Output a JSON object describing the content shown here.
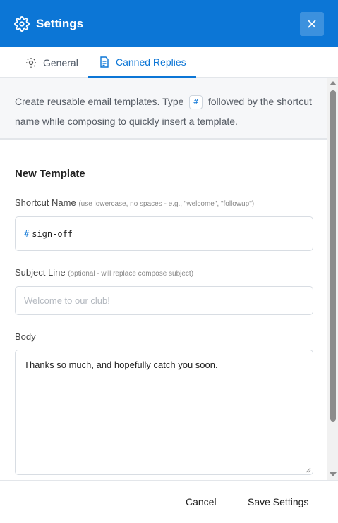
{
  "header": {
    "title": "Settings",
    "close_icon": "close-icon",
    "gear_icon": "gear-icon",
    "color": "#0c76d6"
  },
  "tabs": [
    {
      "label": "General",
      "icon": "sun-settings-icon",
      "active": false
    },
    {
      "label": "Canned Replies",
      "icon": "document-icon",
      "active": true
    }
  ],
  "info": {
    "text_before": "Create reusable email templates. Type",
    "chip": "#",
    "text_after": "followed by the shortcut name while composing to quickly insert a template."
  },
  "form": {
    "section_title": "New Template",
    "shortcut": {
      "label": "Shortcut Name",
      "hint": "(use lowercase, no spaces - e.g., \"welcome\", \"followup\")",
      "prefix": "#",
      "value": "sign-off"
    },
    "subject": {
      "label": "Subject Line",
      "hint": "(optional - will replace compose subject)",
      "placeholder": "Welcome to our club!"
    },
    "body": {
      "label": "Body",
      "value": "Thanks so much, and hopefully catch you soon."
    }
  },
  "footer": {
    "cancel_label": "Cancel",
    "save_label": "Save Settings"
  }
}
